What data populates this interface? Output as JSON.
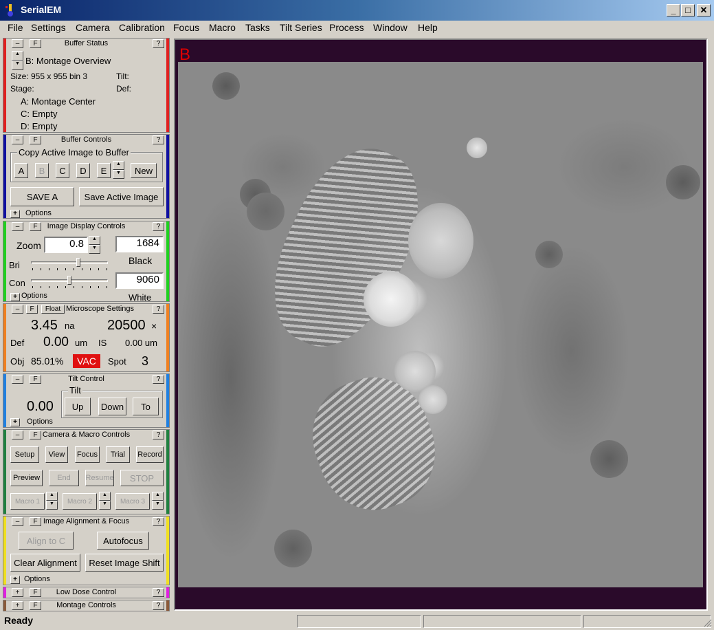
{
  "window": {
    "title": "SerialEM",
    "minimize": "_",
    "maximize": "□",
    "close": "✕",
    "app_icon": "microscope-icon"
  },
  "menu": [
    "File",
    "Settings",
    "Camera",
    "Calibration",
    "Focus",
    "Macro",
    "Tasks",
    "Tilt Series",
    "Process",
    "Window",
    "Help"
  ],
  "common": {
    "minus": "–",
    "float_f": "F",
    "help": "?",
    "plus": "+",
    "options": "Options",
    "up": "▲",
    "down": "▼"
  },
  "buffer_status": {
    "title": "Buffer Status",
    "stripe_color": "#e02020",
    "current": "B: Montage Overview",
    "size": "Size: 955 x 955  bin 3",
    "tilt": "Tilt:",
    "stage": "Stage:",
    "def": "Def:",
    "buffers": [
      "A: Montage Center",
      "C: Empty",
      "D: Empty"
    ]
  },
  "buffer_controls": {
    "title": "Buffer Controls",
    "stripe_color": "#1010a0",
    "group_label": "Copy Active Image to Buffer",
    "buffers": [
      "A",
      "B",
      "C",
      "D",
      "E"
    ],
    "new": "New",
    "save_a": "SAVE A",
    "save_active": "Save Active Image"
  },
  "image_display": {
    "title": "Image Display Controls",
    "stripe_color": "#20d020",
    "zoom_label": "Zoom",
    "zoom": "0.8",
    "black_value": "1684",
    "black_label": "Black",
    "bri_label": "Bri",
    "con_label": "Con",
    "white_value": "9060",
    "white_label": "White",
    "bri_level": 0.62,
    "con_level": 0.5
  },
  "microscope": {
    "title": "Microscope Settings",
    "stripe_color": "#f08020",
    "float_label": "Float",
    "current": "3.45",
    "current_unit": "na",
    "mag": "20500",
    "mag_unit": "×",
    "def_label": "Def",
    "def_value": "0.00",
    "def_unit": "um",
    "is_label": "IS",
    "is_value": "0.00 um",
    "obj_label": "Obj",
    "obj_value": "85.01%",
    "vac": "VAC",
    "vac_color": "#e01010",
    "spot_label": "Spot",
    "spot_value": "3"
  },
  "tilt_control": {
    "title": "Tilt Control",
    "stripe_color": "#2080e0",
    "tilt_value": "0.00",
    "group_label": "Tilt",
    "up": "Up",
    "down": "Down",
    "to": "To"
  },
  "camera_macro": {
    "title": "Camera & Macro Controls",
    "stripe_color": "#208040",
    "row1": [
      "Setup",
      "View",
      "Focus",
      "Trial",
      "Record"
    ],
    "preview": "Preview",
    "end": "End",
    "resume": "Resume",
    "stop": "STOP",
    "macros": [
      "Macro 1",
      "Macro 2",
      "Macro 3"
    ]
  },
  "alignment": {
    "title": "Image Alignment & Focus",
    "stripe_color": "#f0e020",
    "align_to": "Align to C",
    "autofocus": "Autofocus",
    "clear": "Clear Alignment",
    "reset_shift": "Reset Image Shift"
  },
  "low_dose": {
    "title": "Low Dose Control",
    "stripe_color": "#e020e0"
  },
  "montage": {
    "title": "Montage Controls",
    "stripe_color": "#8a5a3a"
  },
  "image": {
    "buffer_label": "B"
  },
  "status": {
    "text": "Ready"
  }
}
